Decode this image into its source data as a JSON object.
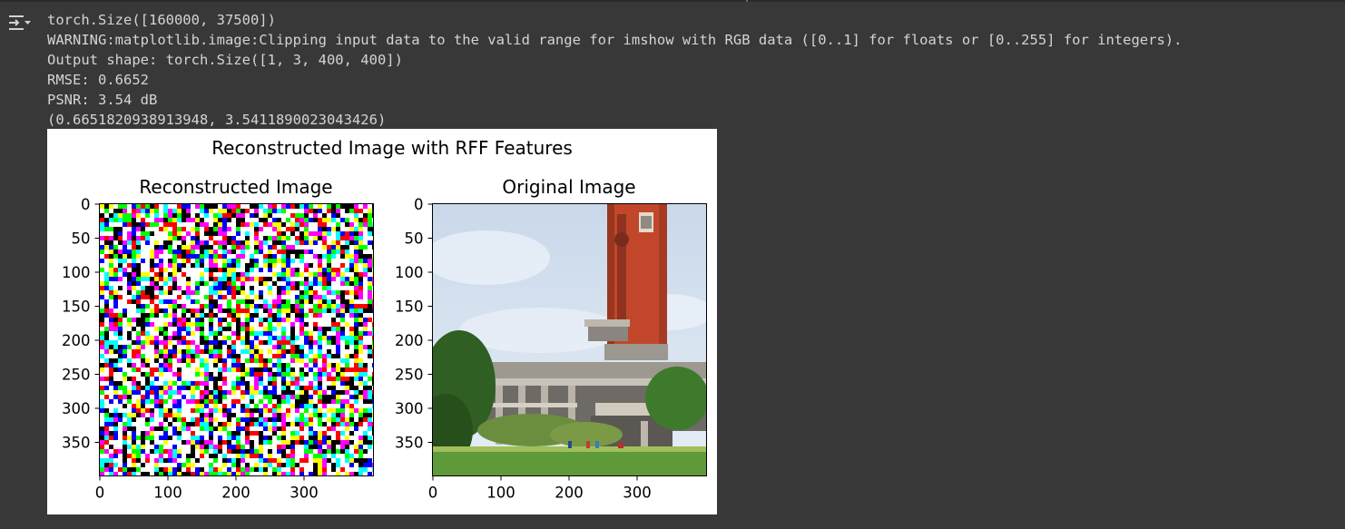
{
  "output_lines": [
    "torch.Size([160000, 37500])",
    "WARNING:matplotlib.image:Clipping input data to the valid range for imshow with RGB data ([0..1] for floats or [0..255] for integers).",
    "Output shape: torch.Size([1, 3, 400, 400])",
    "RMSE: 0.6652",
    "PSNR: 3.54 dB",
    "(0.6651820938913948, 3.5411890023043426)"
  ],
  "gutter": {
    "icon": "output-toggle-icon"
  },
  "figure": {
    "suptitle": "Reconstructed Image with RFF Features",
    "subplots": [
      {
        "title": "Reconstructed Image",
        "content": "rgb-noise",
        "xticks": [
          "0",
          "100",
          "200",
          "300"
        ],
        "yticks": [
          "0",
          "50",
          "100",
          "150",
          "200",
          "250",
          "300",
          "350"
        ]
      },
      {
        "title": "Original Image",
        "content": "photo-red-brick-clock-tower-building-sky-grass",
        "xticks": [
          "0",
          "100",
          "200",
          "300"
        ],
        "yticks": [
          "0",
          "50",
          "100",
          "150",
          "200",
          "250",
          "300",
          "350"
        ]
      }
    ]
  },
  "colors": {
    "background": "#383838",
    "text": "#d4d4d4",
    "figure_bg": "#ffffff",
    "tower": "#c2472a",
    "sky": "#d4e2f1",
    "grass": "#5e9a3a"
  }
}
